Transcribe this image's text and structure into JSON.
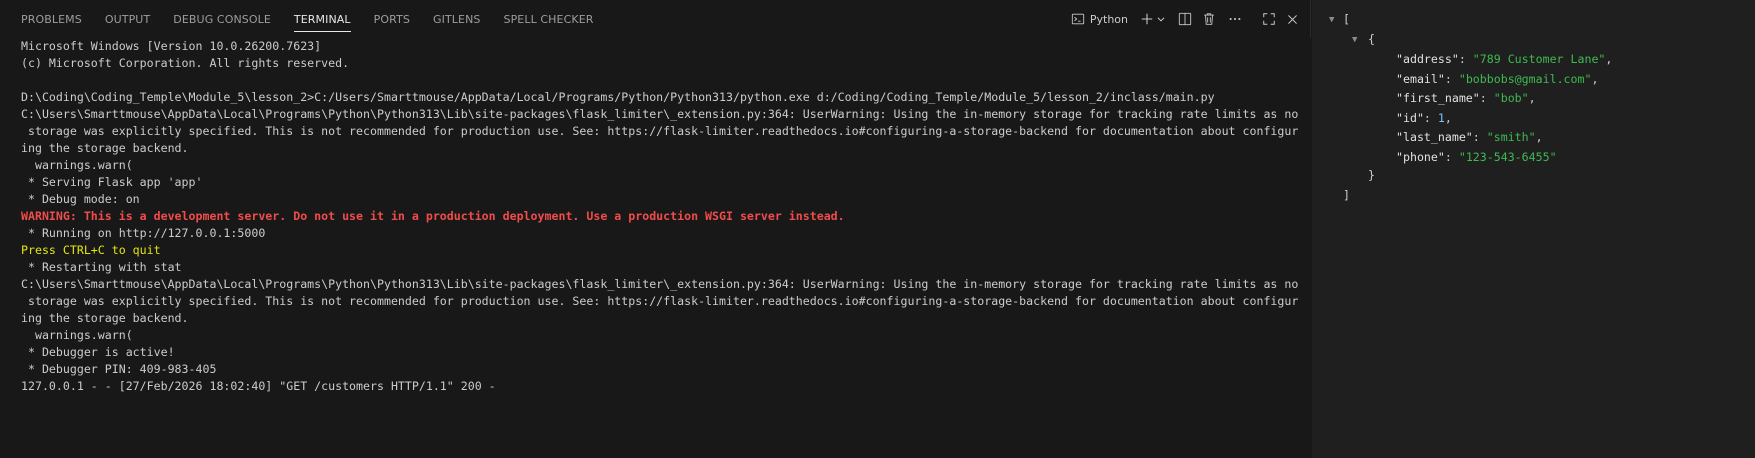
{
  "panel": {
    "tabs": [
      "PROBLEMS",
      "OUTPUT",
      "DEBUG CONSOLE",
      "TERMINAL",
      "PORTS",
      "GITLENS",
      "SPELL CHECKER"
    ],
    "active_tab": "TERMINAL",
    "shell_label": "Python"
  },
  "terminal": {
    "lines": [
      "Microsoft Windows [Version 10.0.26200.7623]",
      "(c) Microsoft Corporation. All rights reserved.",
      "",
      "D:\\Coding\\Coding_Temple\\Module_5\\lesson_2>C:/Users/Smarttmouse/AppData/Local/Programs/Python/Python313/python.exe d:/Coding/Coding_Temple/Module_5/lesson_2/inclass/main.py",
      "C:\\Users\\Smarttmouse\\AppData\\Local\\Programs\\Python\\Python313\\Lib\\site-packages\\flask_limiter\\_extension.py:364: UserWarning: Using the in-memory storage for tracking rate limits as no",
      " storage was explicitly specified. This is not recommended for production use. See: https://flask-limiter.readthedocs.io#configuring-a-storage-backend for documentation about configur",
      "ing the storage backend.",
      "  warnings.warn(",
      " * Serving Flask app 'app'",
      " * Debug mode: on",
      "WARNING: This is a development server. Do not use it in a production deployment. Use a production WSGI server instead.",
      " * Running on http://127.0.0.1:5000",
      "Press CTRL+C to quit",
      " * Restarting with stat",
      "C:\\Users\\Smarttmouse\\AppData\\Local\\Programs\\Python\\Python313\\Lib\\site-packages\\flask_limiter\\_extension.py:364: UserWarning: Using the in-memory storage for tracking rate limits as no",
      " storage was explicitly specified. This is not recommended for production use. See: https://flask-limiter.readthedocs.io#configuring-a-storage-backend for documentation about configur",
      "ing the storage backend.",
      "  warnings.warn(",
      " * Debugger is active!",
      " * Debugger PIN: 409-983-405",
      "127.0.0.1 - - [27/Feb/2026 18:02:40] \"GET /customers HTTP/1.1\" 200 -"
    ],
    "line_styles": [
      "",
      "",
      "",
      "",
      "",
      "",
      "",
      "",
      "",
      "",
      "warn",
      "",
      "yellow",
      "",
      "",
      "",
      "",
      "",
      "",
      "",
      ""
    ]
  },
  "json_view": {
    "open_bracket": "[",
    "close_bracket": "]",
    "open_brace": "{",
    "close_brace": "}",
    "entries": [
      {
        "key": "\"address\"",
        "value": "\"789 Customer Lane\"",
        "type": "string",
        "comma": true
      },
      {
        "key": "\"email\"",
        "value": "\"bobbobs@gmail.com\"",
        "type": "string",
        "comma": true
      },
      {
        "key": "\"first_name\"",
        "value": "\"bob\"",
        "type": "string",
        "comma": true
      },
      {
        "key": "\"id\"",
        "value": "1",
        "type": "number",
        "comma": true
      },
      {
        "key": "\"last_name\"",
        "value": "\"smith\"",
        "type": "string",
        "comma": true
      },
      {
        "key": "\"phone\"",
        "value": "\"123-543-6455\"",
        "type": "string",
        "comma": false
      }
    ]
  },
  "colors": {
    "background": "#181818",
    "json_background": "#1f1f1f",
    "warning_red": "#f14c4c",
    "prompt_yellow": "#e5e510",
    "json_string": "#3fb950",
    "json_number": "#79c0ff"
  },
  "icons": [
    "terminal-icon",
    "plus-icon",
    "chevron-down-icon",
    "split-icon",
    "trash-icon",
    "more-icon",
    "maximize-icon",
    "close-icon",
    "caret-down-icon"
  ]
}
